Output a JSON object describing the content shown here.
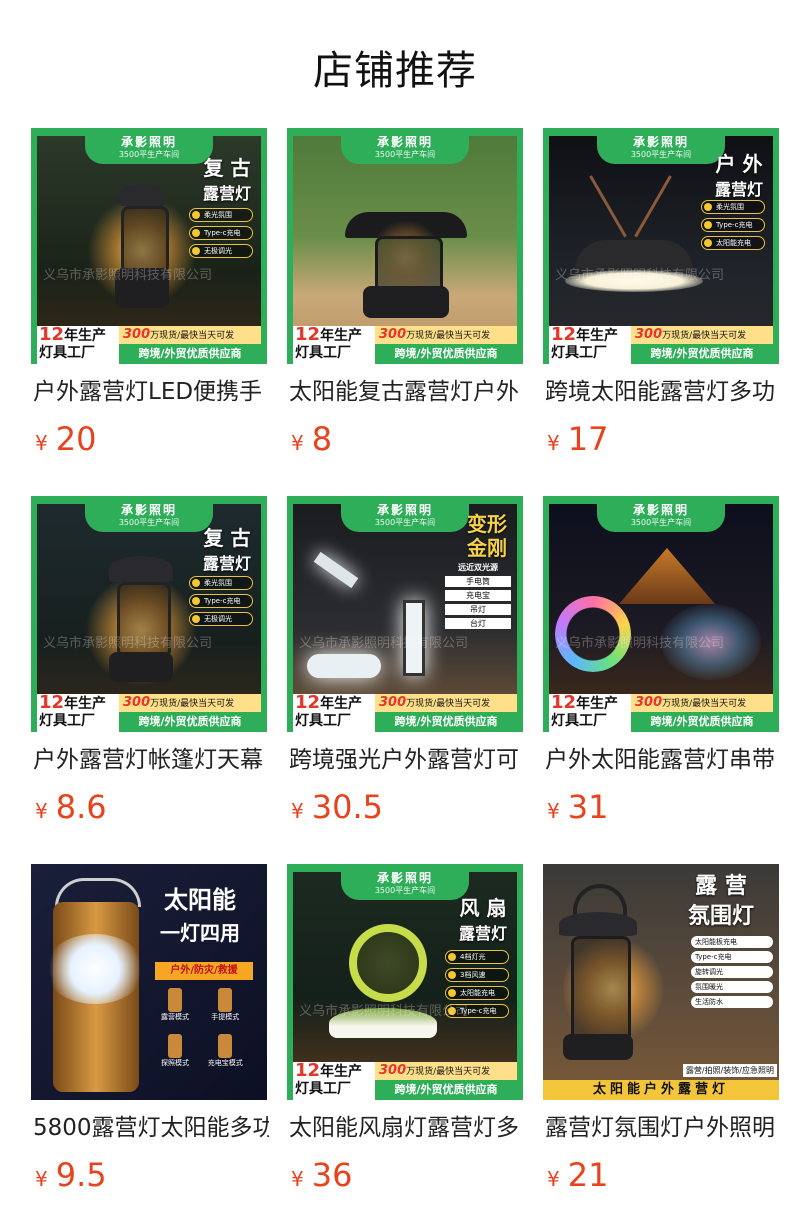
{
  "page": {
    "title": "店铺推荐"
  },
  "badges": {
    "brand": "承影照明",
    "brand_sub": "3500平生产车间",
    "years_num": "12",
    "years_text": "年生产",
    "factory": "灯具工厂",
    "stock_num": "300",
    "stock_text": "万现货/最快当天可发",
    "supply": "跨境/外贸优质供应商",
    "watermark": "义乌市承影照明科技有限公司"
  },
  "colors": {
    "brand_green": "#2fae5a",
    "price_orange": "#e8431c"
  },
  "products": [
    {
      "name": "户外露营灯LED便携手",
      "currency": "¥",
      "price": "20",
      "img": {
        "title": "复古\n露营灯",
        "features": [
          "柔光氛围",
          "Type-c充电",
          "无极调光"
        ]
      }
    },
    {
      "name": "太阳能复古露营灯户外",
      "currency": "¥",
      "price": "8",
      "img": {
        "title": "",
        "features": []
      }
    },
    {
      "name": "跨境太阳能露营灯多功",
      "currency": "¥",
      "price": "17",
      "img": {
        "title": "户外\n露营灯",
        "features": [
          "柔光氛围",
          "Type-c充电",
          "太阳能充电"
        ]
      }
    },
    {
      "name": "户外露营灯帐篷灯天幕",
      "currency": "¥",
      "price": "8.6",
      "img": {
        "title": "复古\n露营灯",
        "features": [
          "柔光氛围",
          "Type-c充电",
          "无极调光"
        ]
      }
    },
    {
      "name": "跨境强光户外露营灯可",
      "currency": "¥",
      "price": "30.5",
      "img": {
        "title": "变形\n金刚",
        "features": [
          "远近双光源",
          "手电筒",
          "充电宝",
          "吊灯",
          "台灯"
        ]
      }
    },
    {
      "name": "户外太阳能露营灯串带",
      "currency": "¥",
      "price": "31",
      "img": {
        "title": "",
        "features": []
      }
    },
    {
      "name": "5800露营灯太阳能多功",
      "currency": "¥",
      "price": "9.5",
      "img": {
        "title": "太阳能\n一灯四用",
        "features": [
          "户外/防灾/救援",
          "露营模式",
          "手提模式",
          "探照模式",
          "充电宝模式"
        ]
      }
    },
    {
      "name": "太阳能风扇灯露营灯多",
      "currency": "¥",
      "price": "36",
      "img": {
        "title": "风扇\n露营灯",
        "features": [
          "4档灯光",
          "3档风速",
          "太阳能充电",
          "Type-c充电"
        ]
      }
    },
    {
      "name": "露营灯氛围灯户外照明",
      "currency": "¥",
      "price": "21",
      "img": {
        "title": "露营\n氛围灯",
        "features": [
          "太阳能板充电",
          "Type-c充电",
          "旋转调光",
          "氛围暖光",
          "生活防水",
          "露营/拍照/装饰/应急照明",
          "太阳能户外露营灯"
        ]
      }
    }
  ]
}
